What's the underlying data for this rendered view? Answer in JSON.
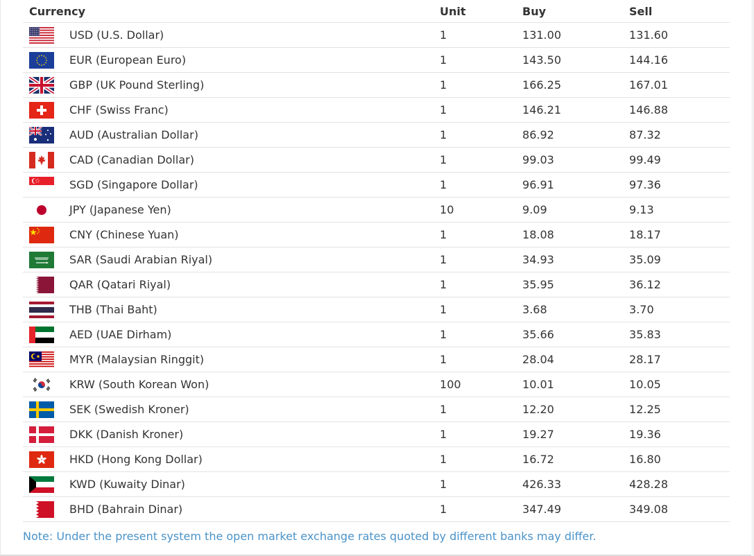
{
  "table": {
    "headers": {
      "currency": "Currency",
      "unit": "Unit",
      "buy": "Buy",
      "sell": "Sell"
    },
    "rows": [
      {
        "code": "usd",
        "name": "USD (U.S. Dollar)",
        "unit": "1",
        "buy": "131.00",
        "sell": "131.60",
        "flag_icon": "us-flag-icon"
      },
      {
        "code": "eur",
        "name": "EUR (European Euro)",
        "unit": "1",
        "buy": "143.50",
        "sell": "144.16",
        "flag_icon": "eu-flag-icon"
      },
      {
        "code": "gbp",
        "name": "GBP (UK Pound Sterling)",
        "unit": "1",
        "buy": "166.25",
        "sell": "167.01",
        "flag_icon": "uk-flag-icon"
      },
      {
        "code": "chf",
        "name": "CHF (Swiss Franc)",
        "unit": "1",
        "buy": "146.21",
        "sell": "146.88",
        "flag_icon": "swiss-flag-icon"
      },
      {
        "code": "aud",
        "name": "AUD (Australian Dollar)",
        "unit": "1",
        "buy": "86.92",
        "sell": "87.32",
        "flag_icon": "australia-flag-icon"
      },
      {
        "code": "cad",
        "name": "CAD (Canadian Dollar)",
        "unit": "1",
        "buy": "99.03",
        "sell": "99.49",
        "flag_icon": "canada-flag-icon"
      },
      {
        "code": "sgd",
        "name": "SGD (Singapore Dollar)",
        "unit": "1",
        "buy": "96.91",
        "sell": "97.36",
        "flag_icon": "singapore-flag-icon"
      },
      {
        "code": "jpy",
        "name": "JPY (Japanese Yen)",
        "unit": "10",
        "buy": "9.09",
        "sell": "9.13",
        "flag_icon": "japan-flag-icon"
      },
      {
        "code": "cny",
        "name": "CNY (Chinese Yuan)",
        "unit": "1",
        "buy": "18.08",
        "sell": "18.17",
        "flag_icon": "china-flag-icon"
      },
      {
        "code": "sar",
        "name": "SAR (Saudi Arabian Riyal)",
        "unit": "1",
        "buy": "34.93",
        "sell": "35.09",
        "flag_icon": "saudi-flag-icon"
      },
      {
        "code": "qar",
        "name": "QAR (Qatari Riyal)",
        "unit": "1",
        "buy": "35.95",
        "sell": "36.12",
        "flag_icon": "qatar-flag-icon"
      },
      {
        "code": "thb",
        "name": "THB (Thai Baht)",
        "unit": "1",
        "buy": "3.68",
        "sell": "3.70",
        "flag_icon": "thailand-flag-icon"
      },
      {
        "code": "aed",
        "name": "AED (UAE Dirham)",
        "unit": "1",
        "buy": "35.66",
        "sell": "35.83",
        "flag_icon": "uae-flag-icon"
      },
      {
        "code": "myr",
        "name": "MYR (Malaysian Ringgit)",
        "unit": "1",
        "buy": "28.04",
        "sell": "28.17",
        "flag_icon": "malaysia-flag-icon"
      },
      {
        "code": "krw",
        "name": "KRW (South Korean Won)",
        "unit": "100",
        "buy": "10.01",
        "sell": "10.05",
        "flag_icon": "korea-flag-icon"
      },
      {
        "code": "sek",
        "name": "SEK (Swedish Kroner)",
        "unit": "1",
        "buy": "12.20",
        "sell": "12.25",
        "flag_icon": "sweden-flag-icon"
      },
      {
        "code": "dkk",
        "name": "DKK (Danish Kroner)",
        "unit": "1",
        "buy": "19.27",
        "sell": "19.36",
        "flag_icon": "denmark-flag-icon"
      },
      {
        "code": "hkd",
        "name": "HKD (Hong Kong Dollar)",
        "unit": "1",
        "buy": "16.72",
        "sell": "16.80",
        "flag_icon": "hongkong-flag-icon"
      },
      {
        "code": "kwd",
        "name": "KWD (Kuwaity Dinar)",
        "unit": "1",
        "buy": "426.33",
        "sell": "428.28",
        "flag_icon": "kuwait-flag-icon"
      },
      {
        "code": "bhd",
        "name": "BHD (Bahrain Dinar)",
        "unit": "1",
        "buy": "347.49",
        "sell": "349.08",
        "flag_icon": "bahrain-flag-icon"
      }
    ]
  },
  "note": "Note: Under the present system the open market exchange rates quoted by different banks may differ.",
  "colors": {
    "text": "#333333",
    "note": "#4a93c9",
    "row_border": "#e2e2e2"
  }
}
